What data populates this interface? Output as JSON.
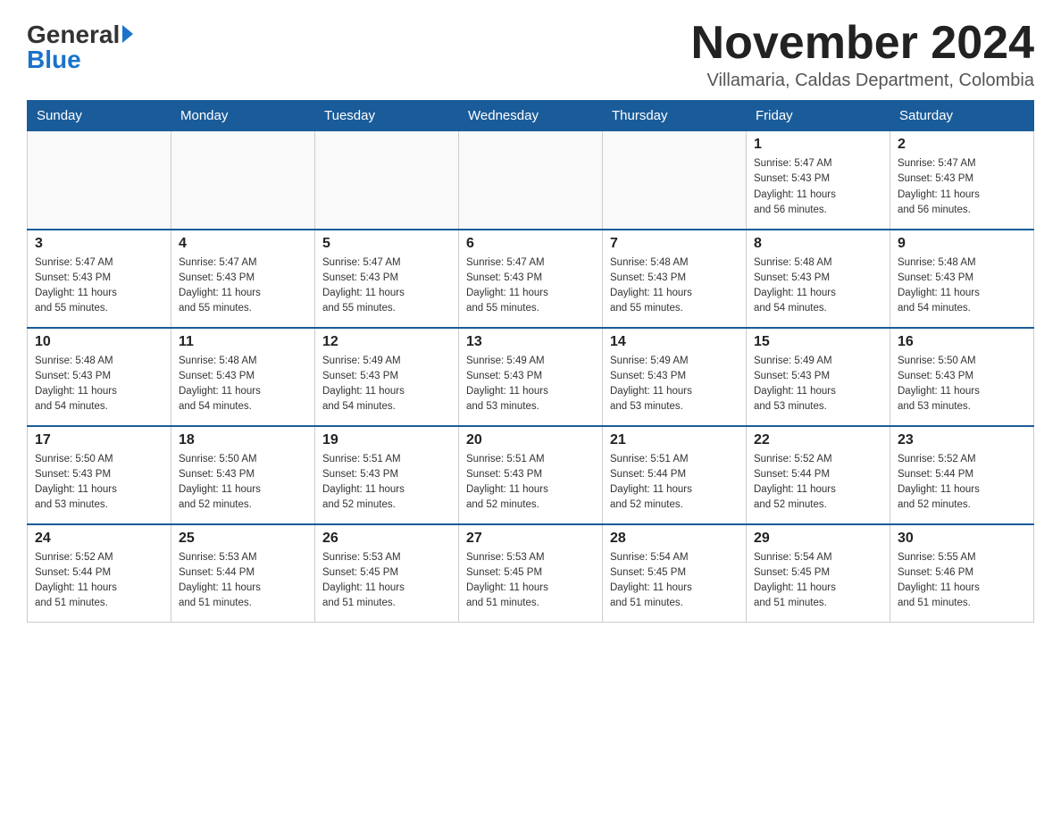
{
  "logo": {
    "general": "General",
    "blue": "Blue"
  },
  "header": {
    "title": "November 2024",
    "location": "Villamaria, Caldas Department, Colombia"
  },
  "days_of_week": [
    "Sunday",
    "Monday",
    "Tuesday",
    "Wednesday",
    "Thursday",
    "Friday",
    "Saturday"
  ],
  "weeks": [
    [
      {
        "day": "",
        "info": ""
      },
      {
        "day": "",
        "info": ""
      },
      {
        "day": "",
        "info": ""
      },
      {
        "day": "",
        "info": ""
      },
      {
        "day": "",
        "info": ""
      },
      {
        "day": "1",
        "info": "Sunrise: 5:47 AM\nSunset: 5:43 PM\nDaylight: 11 hours\nand 56 minutes."
      },
      {
        "day": "2",
        "info": "Sunrise: 5:47 AM\nSunset: 5:43 PM\nDaylight: 11 hours\nand 56 minutes."
      }
    ],
    [
      {
        "day": "3",
        "info": "Sunrise: 5:47 AM\nSunset: 5:43 PM\nDaylight: 11 hours\nand 55 minutes."
      },
      {
        "day": "4",
        "info": "Sunrise: 5:47 AM\nSunset: 5:43 PM\nDaylight: 11 hours\nand 55 minutes."
      },
      {
        "day": "5",
        "info": "Sunrise: 5:47 AM\nSunset: 5:43 PM\nDaylight: 11 hours\nand 55 minutes."
      },
      {
        "day": "6",
        "info": "Sunrise: 5:47 AM\nSunset: 5:43 PM\nDaylight: 11 hours\nand 55 minutes."
      },
      {
        "day": "7",
        "info": "Sunrise: 5:48 AM\nSunset: 5:43 PM\nDaylight: 11 hours\nand 55 minutes."
      },
      {
        "day": "8",
        "info": "Sunrise: 5:48 AM\nSunset: 5:43 PM\nDaylight: 11 hours\nand 54 minutes."
      },
      {
        "day": "9",
        "info": "Sunrise: 5:48 AM\nSunset: 5:43 PM\nDaylight: 11 hours\nand 54 minutes."
      }
    ],
    [
      {
        "day": "10",
        "info": "Sunrise: 5:48 AM\nSunset: 5:43 PM\nDaylight: 11 hours\nand 54 minutes."
      },
      {
        "day": "11",
        "info": "Sunrise: 5:48 AM\nSunset: 5:43 PM\nDaylight: 11 hours\nand 54 minutes."
      },
      {
        "day": "12",
        "info": "Sunrise: 5:49 AM\nSunset: 5:43 PM\nDaylight: 11 hours\nand 54 minutes."
      },
      {
        "day": "13",
        "info": "Sunrise: 5:49 AM\nSunset: 5:43 PM\nDaylight: 11 hours\nand 53 minutes."
      },
      {
        "day": "14",
        "info": "Sunrise: 5:49 AM\nSunset: 5:43 PM\nDaylight: 11 hours\nand 53 minutes."
      },
      {
        "day": "15",
        "info": "Sunrise: 5:49 AM\nSunset: 5:43 PM\nDaylight: 11 hours\nand 53 minutes."
      },
      {
        "day": "16",
        "info": "Sunrise: 5:50 AM\nSunset: 5:43 PM\nDaylight: 11 hours\nand 53 minutes."
      }
    ],
    [
      {
        "day": "17",
        "info": "Sunrise: 5:50 AM\nSunset: 5:43 PM\nDaylight: 11 hours\nand 53 minutes."
      },
      {
        "day": "18",
        "info": "Sunrise: 5:50 AM\nSunset: 5:43 PM\nDaylight: 11 hours\nand 52 minutes."
      },
      {
        "day": "19",
        "info": "Sunrise: 5:51 AM\nSunset: 5:43 PM\nDaylight: 11 hours\nand 52 minutes."
      },
      {
        "day": "20",
        "info": "Sunrise: 5:51 AM\nSunset: 5:43 PM\nDaylight: 11 hours\nand 52 minutes."
      },
      {
        "day": "21",
        "info": "Sunrise: 5:51 AM\nSunset: 5:44 PM\nDaylight: 11 hours\nand 52 minutes."
      },
      {
        "day": "22",
        "info": "Sunrise: 5:52 AM\nSunset: 5:44 PM\nDaylight: 11 hours\nand 52 minutes."
      },
      {
        "day": "23",
        "info": "Sunrise: 5:52 AM\nSunset: 5:44 PM\nDaylight: 11 hours\nand 52 minutes."
      }
    ],
    [
      {
        "day": "24",
        "info": "Sunrise: 5:52 AM\nSunset: 5:44 PM\nDaylight: 11 hours\nand 51 minutes."
      },
      {
        "day": "25",
        "info": "Sunrise: 5:53 AM\nSunset: 5:44 PM\nDaylight: 11 hours\nand 51 minutes."
      },
      {
        "day": "26",
        "info": "Sunrise: 5:53 AM\nSunset: 5:45 PM\nDaylight: 11 hours\nand 51 minutes."
      },
      {
        "day": "27",
        "info": "Sunrise: 5:53 AM\nSunset: 5:45 PM\nDaylight: 11 hours\nand 51 minutes."
      },
      {
        "day": "28",
        "info": "Sunrise: 5:54 AM\nSunset: 5:45 PM\nDaylight: 11 hours\nand 51 minutes."
      },
      {
        "day": "29",
        "info": "Sunrise: 5:54 AM\nSunset: 5:45 PM\nDaylight: 11 hours\nand 51 minutes."
      },
      {
        "day": "30",
        "info": "Sunrise: 5:55 AM\nSunset: 5:46 PM\nDaylight: 11 hours\nand 51 minutes."
      }
    ]
  ]
}
